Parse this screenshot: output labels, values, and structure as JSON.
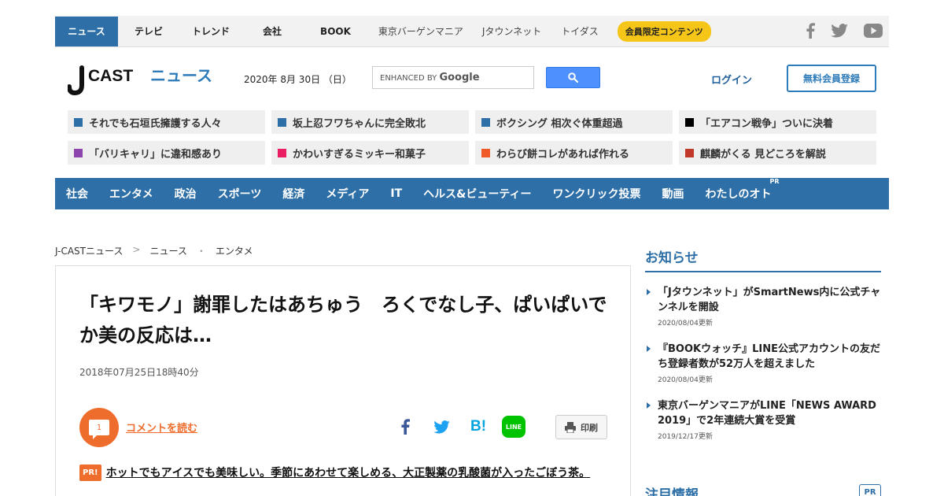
{
  "topbar": {
    "items": [
      "ニュース",
      "テレビ",
      "トレンド",
      "会社",
      "BOOK",
      "東京バーゲンマニア",
      "Jタウンネット",
      "トイダス"
    ],
    "member_pill": "会員限定コンテンツ"
  },
  "header": {
    "logo_text": "CAST",
    "logo_news": "ニュース",
    "date": "2020年 8月 30日 （日）",
    "search_prefix": "ENHANCED BY",
    "search_brand": "Google",
    "login": "ログイン",
    "register": "無料会員登録"
  },
  "topics": [
    {
      "label": "それでも石垣氏擁護する人々",
      "color": "#2d6fa6"
    },
    {
      "label": "坂上忍フワちゃんに完全敗北",
      "color": "#2d6fa6"
    },
    {
      "label": "ボクシング 相次ぐ体重超過",
      "color": "#2d6fa6"
    },
    {
      "label": "「エアコン戦争」ついに決着",
      "color": "#000000"
    },
    {
      "label": "「バリキャリ」に違和感あり",
      "color": "#8e44ad"
    },
    {
      "label": "かわいすぎるミッキー和菓子",
      "color": "#e91e63"
    },
    {
      "label": "わらび餅コレがあれば作れる",
      "color": "#f05a28"
    },
    {
      "label": "麒麟がくる 見どころを解説",
      "color": "#c0392b"
    }
  ],
  "mainnav": {
    "items": [
      "社会",
      "エンタメ",
      "政治",
      "スポーツ",
      "経済",
      "メディア",
      "IT",
      "ヘルス&ビューティー",
      "ワンクリック投票",
      "動画",
      "わたしのオト"
    ],
    "pr": "PR"
  },
  "breadcrumb": {
    "items": [
      "J-CASTニュース",
      "ニュース",
      "エンタメ"
    ],
    "sep1": ">",
    "sep2": "・"
  },
  "article": {
    "title": "「キワモノ」謝罪したはあちゅう　ろくでなし子、ぱいぱいでか美の反応は…",
    "date": "2018年07月25日18時40分",
    "comment_count": "1",
    "comment_link": "コメントを読む",
    "print": "印刷",
    "share_hatena": "B!",
    "share_line": "LINE",
    "pr_badge": "PR!",
    "pr_text": "ホットでもアイスでも美味しい。季節にあわせて楽しめる、大正製薬の乳酸菌が入ったごぼう茶。"
  },
  "sidebar": {
    "title": "お知らせ",
    "notices": [
      {
        "text": "「Jタウンネット」がSmartNews内に公式チャンネルを開設",
        "date": "2020/08/04更新"
      },
      {
        "text": "『BOOKウォッチ』LINE公式アカウントの友だち登録者数が52万人を超えました",
        "date": "2020/08/04更新"
      },
      {
        "text": "東京バーゲンマニアがLINE「NEWS AWARD 2019」で2年連続大賞を受賞",
        "date": "2019/12/17更新"
      }
    ],
    "title2": "注目情報",
    "pr": "PR"
  },
  "colors": {
    "brand_blue": "#2d6fa6",
    "accent_orange": "#ef6d2c",
    "pill_yellow": "#f5c518"
  }
}
